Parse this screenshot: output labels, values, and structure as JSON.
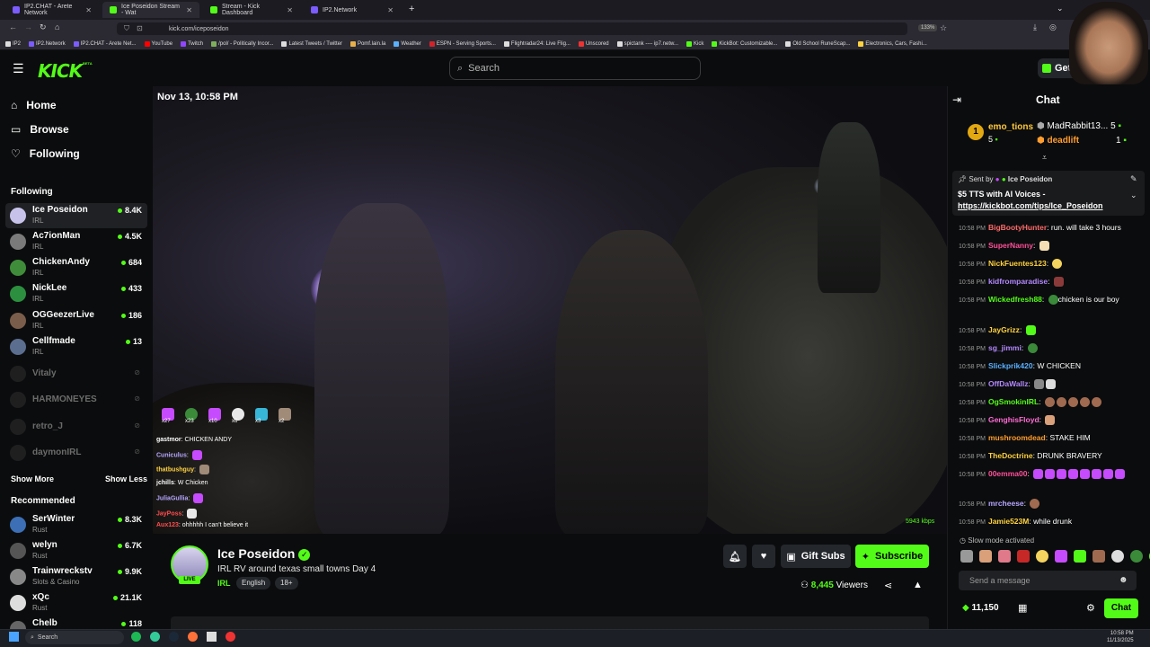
{
  "browser": {
    "tabs": [
      {
        "label": "IP2.CHAT - Arete Network",
        "color": "#7b5cff"
      },
      {
        "label": "Ice Poseidon Stream - Wat",
        "color": "#53fc18"
      },
      {
        "label": "Stream - Kick Dashboard",
        "color": "#53fc18"
      },
      {
        "label": "IP2.Network",
        "color": "#7b5cff"
      }
    ],
    "url": "kick.com/iceposeidon",
    "zoom": "133%",
    "bookmarks": [
      "IP2",
      "IP2.Network",
      "IP2.CHAT - Arete Net...",
      "YouTube",
      "Twitch",
      "/pol/ - Politically Incor...",
      "Latest Tweets / Twitter",
      "Pomf.lain.la",
      "Weather",
      "ESPN - Serving Sports...",
      "Flightradar24: Live Flig...",
      "Unscored",
      "spictank ---- ip7.netw...",
      "Kick",
      "KickBot: Customizable...",
      "Old School RuneScap...",
      "Electronics, Cars, Fashi..."
    ]
  },
  "header": {
    "logo": "KICK",
    "beta": "BETA",
    "search_placeholder": "Search",
    "get_app": "Get"
  },
  "sidebar": {
    "nav": [
      "Home",
      "Browse",
      "Following"
    ],
    "following_title": "Following",
    "following": [
      {
        "name": "Ice Poseidon",
        "cat": "IRL",
        "viewers": "8.4K",
        "online": true
      },
      {
        "name": "Ac7ionMan",
        "cat": "IRL",
        "viewers": "4.5K",
        "online": true
      },
      {
        "name": "ChickenAndy",
        "cat": "IRL",
        "viewers": "684",
        "online": true
      },
      {
        "name": "NickLee",
        "cat": "IRL",
        "viewers": "433",
        "online": true
      },
      {
        "name": "OGGeezerLive",
        "cat": "IRL",
        "viewers": "186",
        "online": true
      },
      {
        "name": "Cellfmade",
        "cat": "IRL",
        "viewers": "13",
        "online": true
      },
      {
        "name": "Vitaly",
        "cat": "",
        "viewers": "",
        "online": false
      },
      {
        "name": "HARMONEYES",
        "cat": "",
        "viewers": "",
        "online": false
      },
      {
        "name": "retro_J",
        "cat": "",
        "viewers": "",
        "online": false
      },
      {
        "name": "daymonIRL",
        "cat": "",
        "viewers": "",
        "online": false
      }
    ],
    "show_more": "Show More",
    "show_less": "Show Less",
    "recommended_title": "Recommended",
    "recommended": [
      {
        "name": "SerWinter",
        "cat": "Rust",
        "viewers": "8.3K"
      },
      {
        "name": "welyn",
        "cat": "Rust",
        "viewers": "6.7K"
      },
      {
        "name": "Trainwreckstv",
        "cat": "Slots & Casino",
        "viewers": "9.9K"
      },
      {
        "name": "xQc",
        "cat": "Rust",
        "viewers": "21.1K"
      },
      {
        "name": "Chelb",
        "cat": "",
        "viewers": "118"
      }
    ]
  },
  "video": {
    "timestamp": "Nov 13, 10:58 PM",
    "bitrate": "5943 kbps",
    "overlay_emote_counts": [
      "x27",
      "x23",
      "x10",
      "x6",
      "x3",
      "x2"
    ],
    "overlay_chat": [
      {
        "user": "gastmor",
        "text": "CHICKEN ANDY",
        "color": "#ffffff"
      },
      {
        "user": "Cuniculus",
        "text": "",
        "color": "#b7a6ff"
      },
      {
        "user": "thatbushguy",
        "text": "",
        "color": "#ffd23f"
      },
      {
        "user": "jchills",
        "text": "W Chicken",
        "color": "#ffffff"
      },
      {
        "user": "JuliaGullia",
        "text": "",
        "color": "#b7a6ff"
      },
      {
        "user": "JayPoss",
        "text": "",
        "color": "#ff4d4d"
      },
      {
        "user": "Aux123",
        "text": "ohhhhh I can't believe it",
        "color": "#ff4d4d"
      }
    ]
  },
  "stream": {
    "name": "Ice Poseidon",
    "title": "IRL RV around texas small towns Day 4",
    "category": "IRL",
    "tags": [
      "English",
      "18+"
    ],
    "live": "LIVE",
    "viewers": "8,445",
    "viewers_label": "Viewers",
    "gift_subs": "Gift Subs",
    "subscribe": "Subscribe"
  },
  "chat": {
    "title": "Chat",
    "leaderboard": [
      {
        "rank": "1",
        "name": "emo_tions",
        "count": "5",
        "color": "#ffc93c"
      },
      {
        "rank": "",
        "name": "MadRabbit13...",
        "count": "5",
        "color": "#ffffff"
      },
      {
        "rank": "",
        "name": "deadlift",
        "count": "1",
        "color": "#ff9d2e"
      }
    ],
    "pinned_by": "Sent by",
    "pinned_user": "Ice Poseidon",
    "pinned_text": "$5 TTS with AI Voices - ",
    "pinned_link": "https://kickbot.com/tips/Ice_Poseidon",
    "messages": [
      {
        "time": "10:58 PM",
        "user": "BigBootyHunter",
        "color": "#ff6b6b",
        "text": "run. will take 3 hours"
      },
      {
        "time": "10:58 PM",
        "user": "SuperNanny",
        "color": "#ff4f9a",
        "text": ""
      },
      {
        "time": "10:58 PM",
        "user": "NickFuentes123",
        "color": "#ffd23f",
        "text": ""
      },
      {
        "time": "10:58 PM",
        "user": "kidfromparadise",
        "color": "#b388ff",
        "text": ""
      },
      {
        "time": "10:58 PM",
        "user": "Wickedfresh88",
        "color": "#53fc18",
        "text": "chicken is our boy"
      },
      {
        "time": "10:58 PM",
        "user": "JayGrizz",
        "color": "#ffd23f",
        "text": ""
      },
      {
        "time": "10:58 PM",
        "user": "sg_jimmi",
        "color": "#b388ff",
        "text": ""
      },
      {
        "time": "10:58 PM",
        "user": "Slickprik420",
        "color": "#5ab0ff",
        "text": "W CHICKEN"
      },
      {
        "time": "10:58 PM",
        "user": "OffDaWallz",
        "color": "#b388ff",
        "text": ""
      },
      {
        "time": "10:58 PM",
        "user": "OgSmokinIRL",
        "color": "#53fc18",
        "text": ""
      },
      {
        "time": "10:58 PM",
        "user": "GenghisFloyd",
        "color": "#ff6bd5",
        "text": ""
      },
      {
        "time": "10:58 PM",
        "user": "mushroomdead",
        "color": "#ff9d2e",
        "text": "STAKE HIM"
      },
      {
        "time": "10:58 PM",
        "user": "TheDoctrine",
        "color": "#ffd23f",
        "text": "DRUNK BRAVERY"
      },
      {
        "time": "10:58 PM",
        "user": "00emma00",
        "color": "#ff4f9a",
        "text": ""
      },
      {
        "time": "10:58 PM",
        "user": "mrcheese",
        "color": "#b7a6ff",
        "text": ""
      },
      {
        "time": "10:58 PM",
        "user": "Jamie523M",
        "color": "#ffd23f",
        "text": "while drunk"
      }
    ],
    "slow_mode": "Slow mode activated",
    "input_placeholder": "Send a message",
    "points": "11,150",
    "send": "Chat"
  },
  "taskbar": {
    "search": "Search",
    "time": "10:58 PM",
    "date": "11/13/2025"
  }
}
